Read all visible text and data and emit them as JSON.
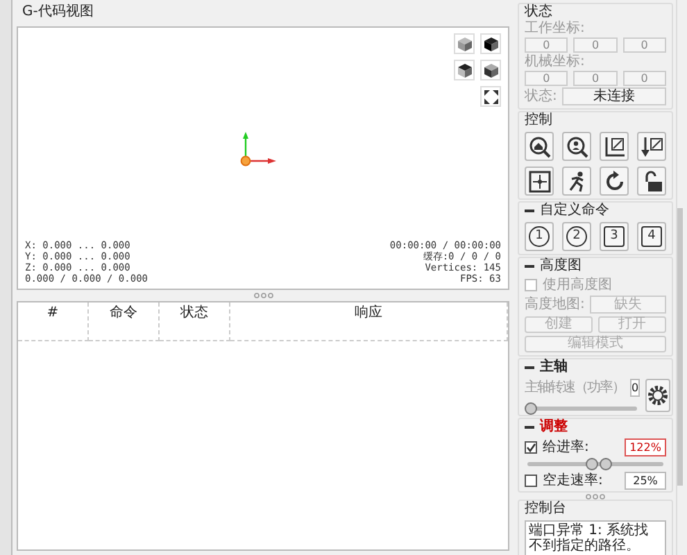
{
  "viewer": {
    "title": "G-代码视图",
    "info_left": [
      "X: 0.000 ... 0.000",
      "Y: 0.000 ... 0.000",
      "Z: 0.000 ... 0.000",
      "0.000 / 0.000 / 0.000"
    ],
    "info_right": [
      "00:00:00 / 00:00:00",
      "缓存:0 / 0 / 0",
      "Vertices: 145",
      "FPS: 63"
    ]
  },
  "table": {
    "columns": [
      "#",
      "命令",
      "状态",
      "响应"
    ]
  },
  "status": {
    "title": "状态",
    "work_label": "工作坐标:",
    "work": [
      "0",
      "0",
      "0"
    ],
    "machine_label": "机械坐标:",
    "machine": [
      "0",
      "0",
      "0"
    ],
    "state_label": "状态:",
    "state": "未连接"
  },
  "control": {
    "title": "控制"
  },
  "custom_commands": {
    "title": "自定义命令",
    "expanded": true,
    "buttons": [
      {
        "label": "1",
        "kind": "circle"
      },
      {
        "label": "2",
        "kind": "circle"
      },
      {
        "label": "3",
        "kind": "square"
      },
      {
        "label": "4",
        "kind": "square"
      }
    ]
  },
  "heightmap": {
    "title": "高度图",
    "expanded": true,
    "disabled": true,
    "use_label": "使用高度图",
    "use_checked": false,
    "map_label": "高度地图:",
    "map_value": "缺失",
    "buttons": [
      "创建",
      "打开"
    ],
    "edit_button": "编辑模式"
  },
  "spindle": {
    "title": "主轴",
    "expanded": true,
    "speed_label": "主轴转速（功率）",
    "speed": "0",
    "level": 0
  },
  "overrides": {
    "title": "调整",
    "expanded": true,
    "items": [
      {
        "label": "给进率:",
        "checked": true,
        "value": "122%",
        "thumbs": [
          {
            "level": 0.47
          },
          {
            "level": 0.57
          }
        ]
      },
      {
        "label": "空走速率:",
        "checked": false,
        "value": "25%"
      }
    ]
  },
  "console": {
    "title": "控制台",
    "text": "端口异常 1: 系统找不到指定的路径。"
  }
}
